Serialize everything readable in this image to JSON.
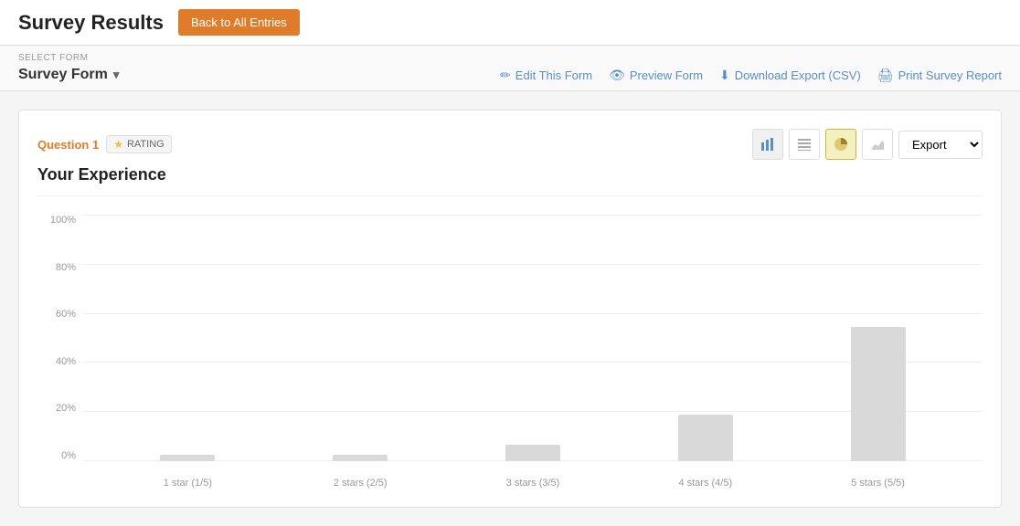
{
  "header": {
    "title": "Survey Results",
    "back_button": "Back to All Entries"
  },
  "form_toolbar": {
    "select_form_label": "SELECT FORM",
    "form_name": "Survey Form",
    "actions": [
      {
        "id": "edit",
        "label": "Edit This Form",
        "icon": "✏️"
      },
      {
        "id": "preview",
        "label": "Preview Form",
        "icon": "👁"
      },
      {
        "id": "download",
        "label": "Download Export (CSV)",
        "icon": "⬇"
      },
      {
        "id": "print",
        "label": "Print Survey Report",
        "icon": "🖨"
      }
    ]
  },
  "question": {
    "label": "Question 1",
    "type": "RATING",
    "title": "Your Experience"
  },
  "chart": {
    "export_label": "Export",
    "y_labels": [
      "0%",
      "20%",
      "40%",
      "60%",
      "80%",
      "100%"
    ],
    "bars": [
      {
        "label": "1 star (1/5)",
        "value": 3,
        "height_pct": 3
      },
      {
        "label": "2 stars (2/5)",
        "value": 3,
        "height_pct": 3
      },
      {
        "label": "3 stars (3/5)",
        "value": 8,
        "height_pct": 8
      },
      {
        "label": "4 stars (4/5)",
        "value": 22,
        "height_pct": 22
      },
      {
        "label": "5 stars (5/5)",
        "value": 64,
        "height_pct": 64
      }
    ]
  }
}
